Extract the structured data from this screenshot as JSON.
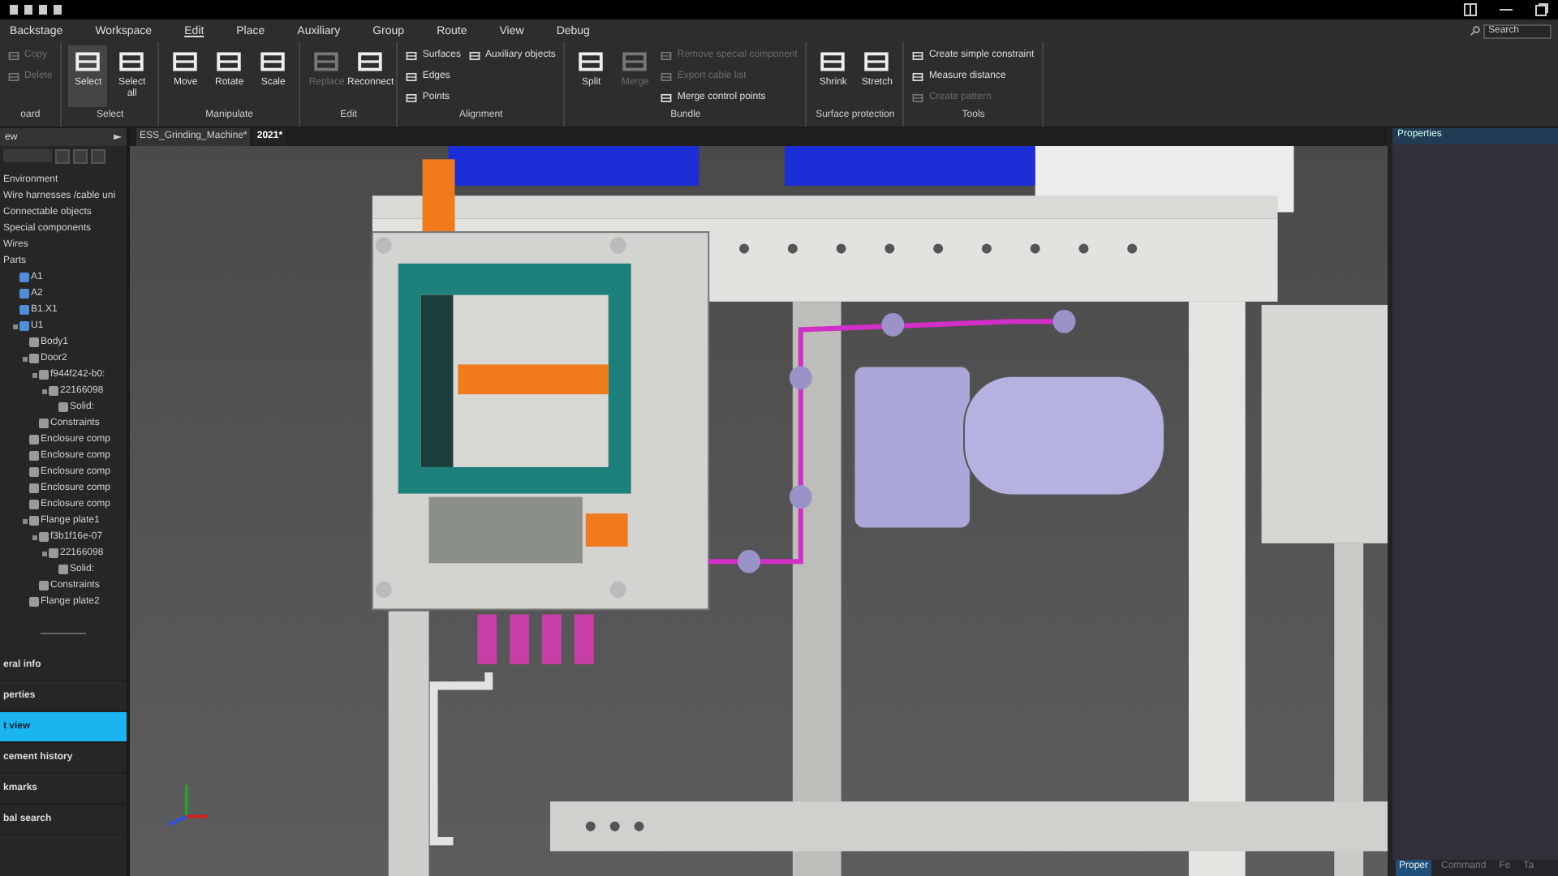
{
  "menu": [
    {
      "label": "Backstage",
      "selected": false
    },
    {
      "label": "Workspace",
      "selected": false
    },
    {
      "label": "Edit",
      "selected": true
    },
    {
      "label": "Place",
      "selected": false
    },
    {
      "label": "Auxiliary",
      "selected": false
    },
    {
      "label": "Group",
      "selected": false
    },
    {
      "label": "Route",
      "selected": false
    },
    {
      "label": "View",
      "selected": false
    },
    {
      "label": "Debug",
      "selected": false
    }
  ],
  "search": {
    "placeholder": "Search"
  },
  "ribbon": [
    {
      "label": "oard",
      "items": [
        {
          "kind": "small",
          "label": "Copy",
          "disabled": true,
          "selected": false
        },
        {
          "kind": "small",
          "label": "Delete",
          "disabled": true,
          "selected": false
        }
      ]
    },
    {
      "label": "Select",
      "items": [
        {
          "kind": "large",
          "label": "Select",
          "disabled": false,
          "selected": true
        },
        {
          "kind": "large",
          "label": "Select all",
          "disabled": false,
          "selected": false
        }
      ]
    },
    {
      "label": "Manipulate",
      "items": [
        {
          "kind": "large",
          "label": "Move",
          "disabled": false,
          "selected": false
        },
        {
          "kind": "large",
          "label": "Rotate",
          "disabled": false,
          "selected": false
        },
        {
          "kind": "large",
          "label": "Scale",
          "disabled": false,
          "selected": false
        }
      ]
    },
    {
      "label": "Edit",
      "items": [
        {
          "kind": "large",
          "label": "Replace",
          "disabled": true,
          "selected": false
        },
        {
          "kind": "large",
          "label": "Reconnect",
          "disabled": false,
          "selected": false
        }
      ]
    },
    {
      "label": "Alignment",
      "items": [
        {
          "kind": "small",
          "label": "Surfaces",
          "disabled": false,
          "selected": false
        },
        {
          "kind": "small",
          "label": "Edges",
          "disabled": false,
          "selected": false
        },
        {
          "kind": "small",
          "label": "Points",
          "disabled": false,
          "selected": false
        },
        {
          "kind": "small",
          "label": "Auxiliary objects",
          "disabled": false,
          "selected": false
        }
      ]
    },
    {
      "label": "Bundle",
      "items": [
        {
          "kind": "large",
          "label": "Split",
          "disabled": false,
          "selected": false
        },
        {
          "kind": "large",
          "label": "Merge",
          "disabled": true,
          "selected": false
        },
        {
          "kind": "small",
          "label": "Remove special component",
          "disabled": true,
          "selected": false
        },
        {
          "kind": "small",
          "label": "Export cable list",
          "disabled": true,
          "selected": false
        },
        {
          "kind": "small",
          "label": "Merge control points",
          "disabled": false,
          "selected": false
        }
      ]
    },
    {
      "label": "Surface protection",
      "items": [
        {
          "kind": "large",
          "label": "Shrink",
          "disabled": false,
          "selected": false
        },
        {
          "kind": "large",
          "label": "Stretch",
          "disabled": false,
          "selected": false
        }
      ]
    },
    {
      "label": "Tools",
      "items": [
        {
          "kind": "small",
          "label": "Create simple constraint",
          "disabled": false,
          "selected": false
        },
        {
          "kind": "small",
          "label": "Measure distance",
          "disabled": false,
          "selected": false
        },
        {
          "kind": "small",
          "label": "Create pattern",
          "disabled": true,
          "selected": false
        }
      ]
    }
  ],
  "left_panel": {
    "title": "ew",
    "tree": [
      {
        "label": "Environment"
      },
      {
        "label": "Wire harnesses /cable uni"
      },
      {
        "label": "Connectable objects"
      },
      {
        "label": "Special components"
      },
      {
        "label": "Wires"
      },
      {
        "label": "Parts",
        "children": [
          {
            "label": "A1"
          },
          {
            "label": "A2"
          },
          {
            "label": "B1.X1"
          },
          {
            "label": "U1",
            "children": [
              {
                "label": "Body1"
              },
              {
                "label": "Door2",
                "children": [
                  {
                    "label": "f944f242-b0:",
                    "children": [
                      {
                        "label": "22166098",
                        "children": [
                          {
                            "label": "Solid:"
                          }
                        ]
                      }
                    ]
                  },
                  {
                    "label": "Constraints"
                  }
                ]
              },
              {
                "label": "Enclosure comp"
              },
              {
                "label": "Enclosure comp"
              },
              {
                "label": "Enclosure comp"
              },
              {
                "label": "Enclosure comp"
              },
              {
                "label": "Enclosure comp"
              },
              {
                "label": "Flange plate1",
                "children": [
                  {
                    "label": "f3b1f16e-07",
                    "children": [
                      {
                        "label": "22166098",
                        "children": [
                          {
                            "label": "Solid:"
                          }
                        ]
                      }
                    ]
                  },
                  {
                    "label": "Constraints"
                  }
                ]
              },
              {
                "label": "Flange plate2"
              }
            ]
          }
        ]
      }
    ],
    "sections": [
      {
        "label": "eral info",
        "selected": false
      },
      {
        "label": "perties",
        "selected": false
      },
      {
        "label": "t view",
        "selected": true
      },
      {
        "label": "cement history",
        "selected": false
      },
      {
        "label": "kmarks",
        "selected": false
      },
      {
        "label": "bal search",
        "selected": false
      }
    ]
  },
  "documents": [
    {
      "label": "ESS_Grinding_Machine*",
      "selected": false
    },
    {
      "label": "2021*",
      "selected": true
    }
  ],
  "right_panel": {
    "title": "Properties",
    "tabs": [
      {
        "label": "Proper",
        "selected": true
      },
      {
        "label": "Command",
        "selected": false
      },
      {
        "label": "Fe",
        "selected": false
      },
      {
        "label": "Ta",
        "selected": false
      }
    ]
  }
}
